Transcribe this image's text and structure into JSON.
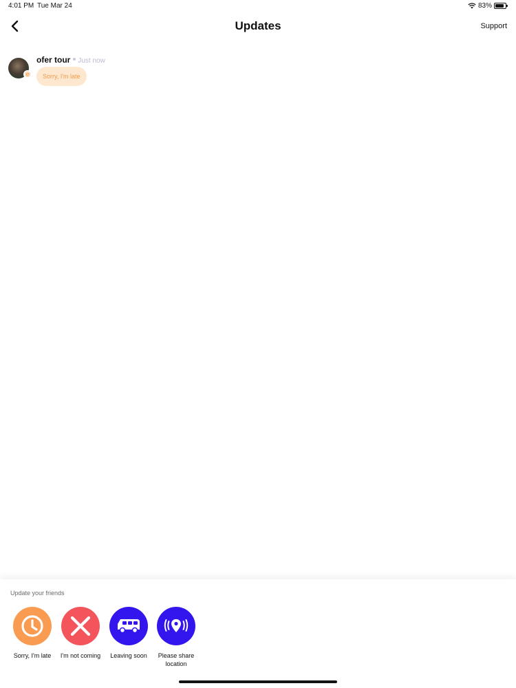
{
  "status_bar": {
    "time": "4:01 PM",
    "date": "Tue Mar 24",
    "battery_text": "83%",
    "battery_level": 0.83,
    "wifi_icon": "wifi-icon",
    "battery_icon": "battery-icon"
  },
  "header": {
    "back_icon": "chevron-left-icon",
    "title": "Updates",
    "support_label": "Support"
  },
  "updates": [
    {
      "user_name": "ofer tour",
      "timestamp": "Just now",
      "message": "Sorry, I'm late",
      "badge_icon": "clock-icon"
    }
  ],
  "panel": {
    "title": "Update your friends",
    "actions": [
      {
        "label": "Sorry, I'm late",
        "icon": "clock-icon",
        "color": "#f99c52"
      },
      {
        "label": "I'm not coming",
        "icon": "close-icon",
        "color": "#f4555d"
      },
      {
        "label": "Leaving soon",
        "icon": "van-icon",
        "color": "#3316ee"
      },
      {
        "label": "Please share location",
        "icon": "location-broadcast-icon",
        "color": "#3316ee"
      }
    ]
  },
  "colors": {
    "accent_orange": "#f99c52",
    "accent_red": "#f4555d",
    "accent_blue": "#3316ee",
    "pill_background": "#fde8cf",
    "pill_text": "#f19a4a"
  }
}
